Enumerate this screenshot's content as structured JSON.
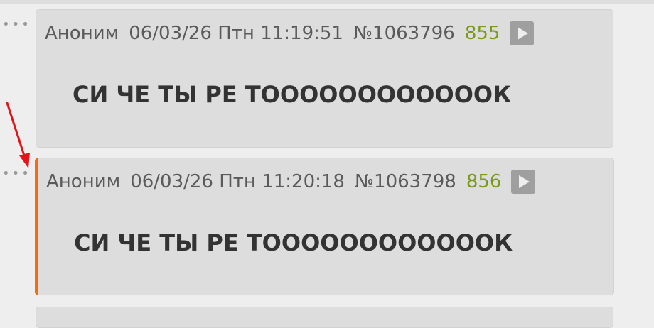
{
  "posts": [
    {
      "author": "Аноним",
      "date": "06/03/26 Птн 11:19:51",
      "id": "№1063796",
      "reply_count": "855",
      "text": "СИ ЧЕ ТЫ РЕ ТООООООООООООК",
      "highlighted": false
    },
    {
      "author": "Аноним",
      "date": "06/03/26 Птн 11:20:18",
      "id": "№1063798",
      "reply_count": "856",
      "text": "СИ ЧЕ ТЫ РЕ ТООООООООООООК",
      "highlighted": true
    }
  ],
  "colors": {
    "accent_highlight": "#f46b12",
    "reply_count": "#7a9a1a",
    "annotation_arrow": "#e0161b"
  },
  "icons": {
    "post_menu": "more-dots-icon",
    "play": "play-icon",
    "annotation": "red-arrow-annotation"
  }
}
